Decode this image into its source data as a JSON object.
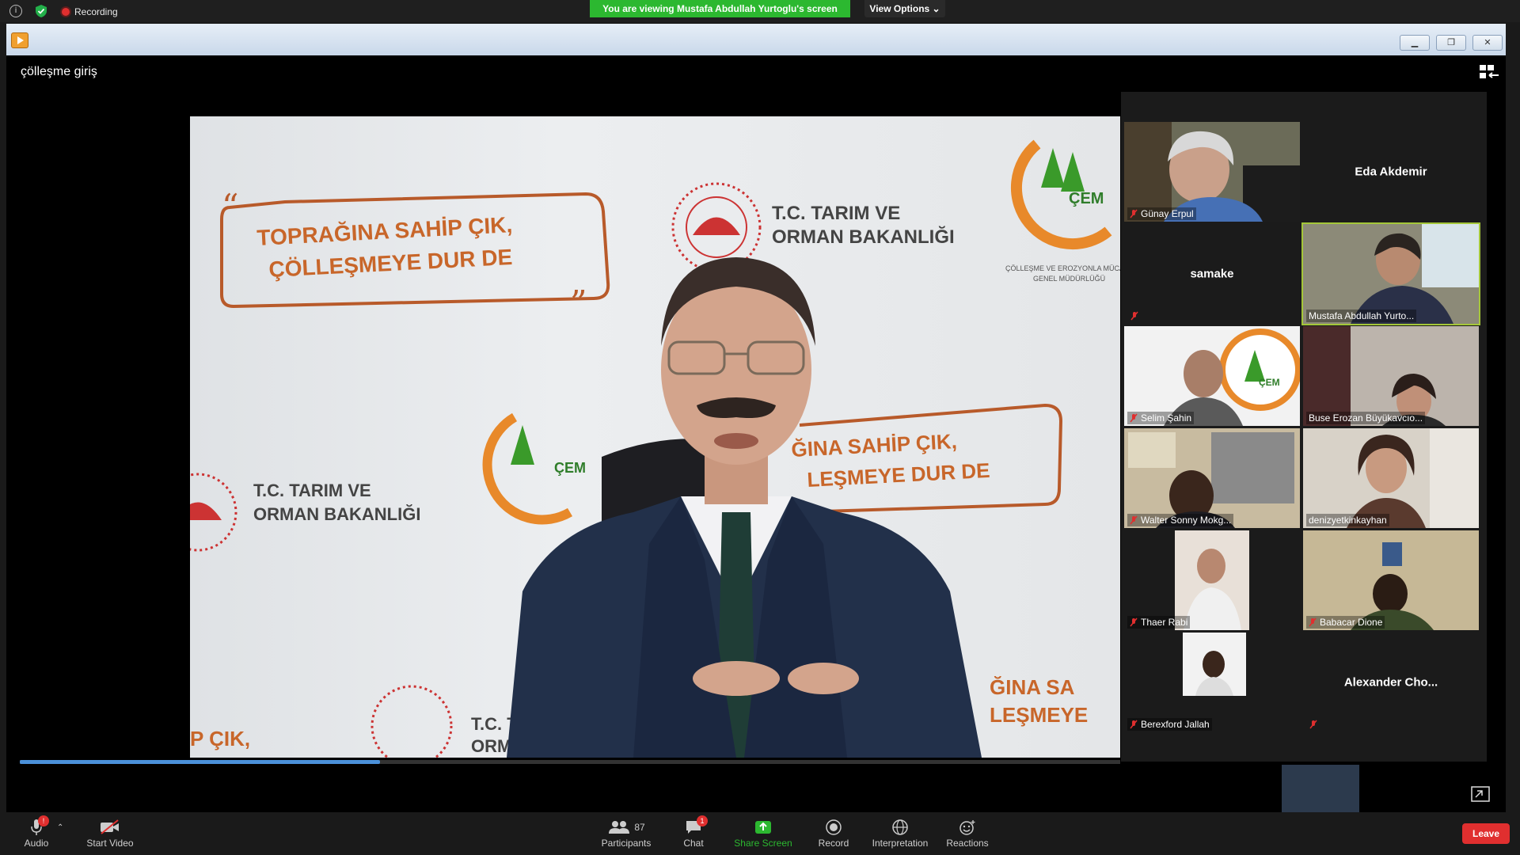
{
  "status_bar": {
    "recording_label": "Recording",
    "viewing_banner": "You are viewing Mustafa Abdullah Yurtoglu's screen",
    "view_options": "View Options ⌄"
  },
  "shared_window": {
    "title": "çölleşme giriş"
  },
  "slide": {
    "banner_line1": "TOPRAĞINA SAHİP ÇIK,",
    "banner_line2": "ÇÖLLEŞMEYE DUR DE",
    "ministry_line1": "T.C. TARIM VE",
    "ministry_line2": "ORMAN BAKANLIĞI",
    "cem_logo": "ÇEM",
    "cem_sub1": "ÇÖLLEŞME VE EROZYONLA MÜCADELE",
    "cem_sub2": "GENEL MÜDÜRLÜĞÜ",
    "left_ministry_line1": "T.C. TARIM VE",
    "left_ministry_line2": "ORMAN BAKANLIĞI",
    "repeat_line1": "ĞINA SAHİP ÇIK,",
    "repeat_line2": "LEŞMEYE DUR DE",
    "bottom_left": "P ÇIK,",
    "bottom_mid": "T.C. TA",
    "bottom_mid2": "ORM",
    "bottom_right1": "ĞINA SA",
    "bottom_right2": "LEŞMEYE"
  },
  "participants": [
    {
      "name": "Günay Erpul",
      "video": true,
      "muted": true
    },
    {
      "name": "Eda Akdemir",
      "video": false,
      "muted": false
    },
    {
      "name": "samake",
      "video": false,
      "muted": true
    },
    {
      "name": "Mustafa Abdullah Yurto...",
      "video": true,
      "muted": false,
      "active": true
    },
    {
      "name": "Selim Şahin",
      "video": true,
      "muted": true
    },
    {
      "name": "Buse Erozan Büyükavcıo...",
      "video": true,
      "muted": false
    },
    {
      "name": "Walter Sonny Mokg...",
      "video": true,
      "muted": true
    },
    {
      "name": "denizyetkinkayhan",
      "video": true,
      "muted": false
    },
    {
      "name": "Thaer Rabi",
      "video": true,
      "muted": true
    },
    {
      "name": "Babacar Dione",
      "video": true,
      "muted": true
    },
    {
      "name": "Berexford Jallah",
      "video": true,
      "muted": true
    },
    {
      "name": "Alexander  Cho...",
      "video": false,
      "muted": true
    }
  ],
  "toolbar": {
    "audio": "Audio",
    "audio_badge": "!",
    "start_video": "Start Video",
    "participants": "Participants",
    "participants_count": "87",
    "chat": "Chat",
    "chat_badge": "1",
    "share_screen": "Share Screen",
    "record": "Record",
    "interpretation": "Interpretation",
    "reactions": "Reactions",
    "leave": "Leave"
  },
  "colors": {
    "banner_green": "#2cb830",
    "leave_red": "#e02f2f",
    "active_speaker": "#a4c639",
    "slide_orange": "#c8662a"
  }
}
